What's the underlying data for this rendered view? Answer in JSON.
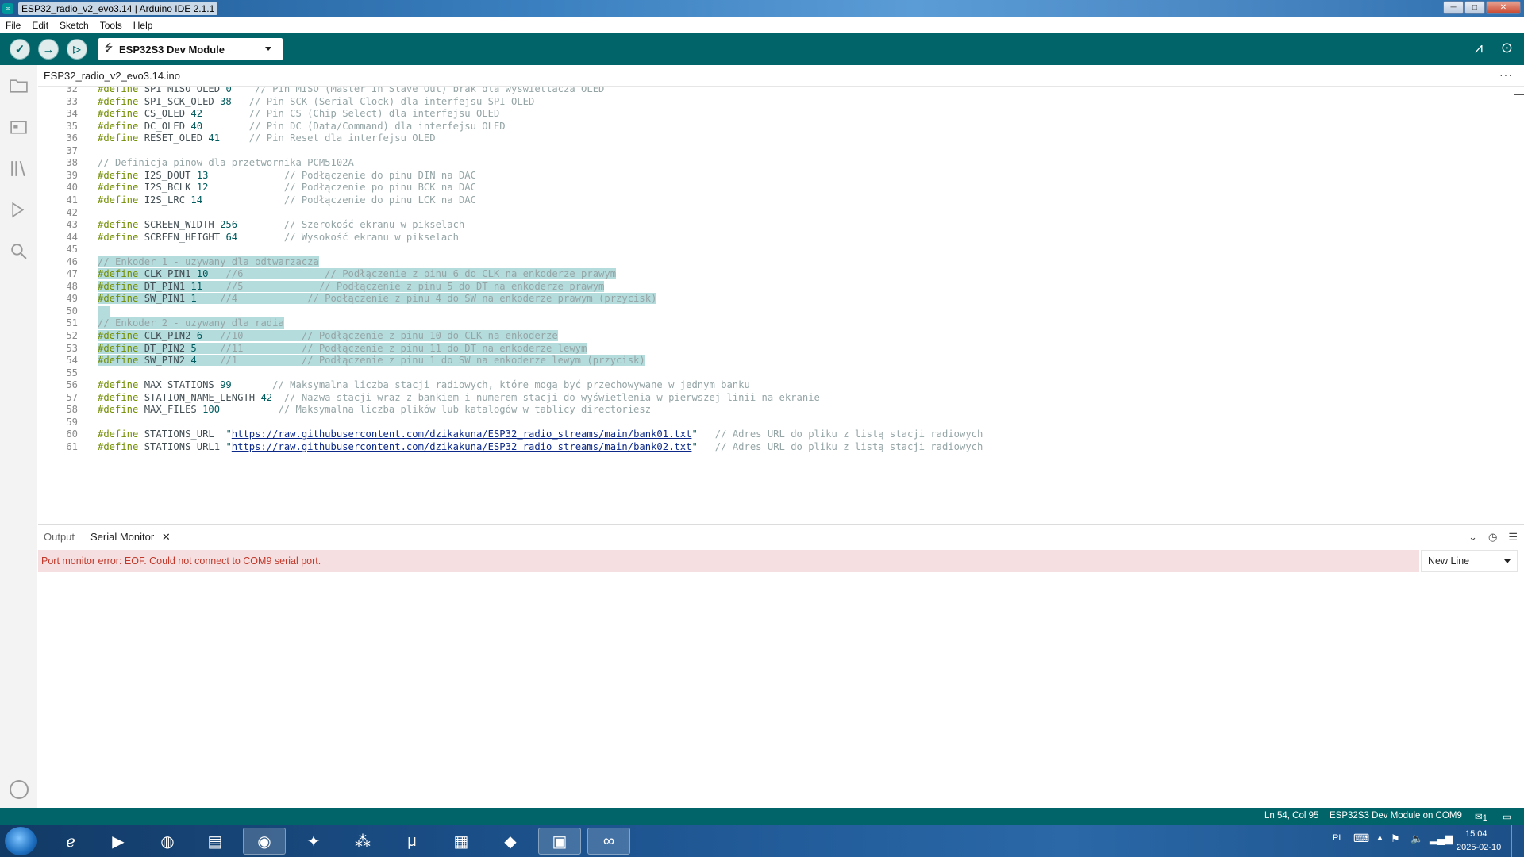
{
  "window": {
    "title": "ESP32_radio_v2_evo3.14 | Arduino IDE 2.1.1",
    "controls": [
      "minimize",
      "maximize",
      "close"
    ]
  },
  "menu": [
    "File",
    "Edit",
    "Sketch",
    "Tools",
    "Help"
  ],
  "toolbar": {
    "board": "ESP32S3 Dev Module",
    "buttons": [
      "verify",
      "upload",
      "debug"
    ]
  },
  "editor": {
    "file_tab": "ESP32_radio_v2_evo3.14.ino",
    "lines": [
      {
        "n": "32",
        "segs": [
          [
            "kw",
            "#define "
          ],
          [
            "",
            "SPI_MISO_OLED "
          ],
          [
            "num",
            "0"
          ],
          [
            "cm",
            "    // Pin MISO (Master In Slave Out) brak dla wyświetlacza OLED"
          ]
        ]
      },
      {
        "n": "33",
        "segs": [
          [
            "kw",
            "#define "
          ],
          [
            "",
            "SPI_SCK_OLED "
          ],
          [
            "num",
            "38"
          ],
          [
            "cm",
            "   // Pin SCK (Serial Clock) dla interfejsu SPI OLED"
          ]
        ]
      },
      {
        "n": "34",
        "segs": [
          [
            "kw",
            "#define "
          ],
          [
            "",
            "CS_OLED "
          ],
          [
            "num",
            "42"
          ],
          [
            "cm",
            "        // Pin CS (Chip Select) dla interfejsu OLED"
          ]
        ]
      },
      {
        "n": "35",
        "segs": [
          [
            "kw",
            "#define "
          ],
          [
            "",
            "DC_OLED "
          ],
          [
            "num",
            "40"
          ],
          [
            "cm",
            "        // Pin DC (Data/Command) dla interfejsu OLED"
          ]
        ]
      },
      {
        "n": "36",
        "segs": [
          [
            "kw",
            "#define "
          ],
          [
            "",
            "RESET_OLED "
          ],
          [
            "num",
            "41"
          ],
          [
            "cm",
            "     // Pin Reset dla interfejsu OLED"
          ]
        ]
      },
      {
        "n": "37",
        "segs": []
      },
      {
        "n": "38",
        "segs": [
          [
            "cm",
            "// Definicja pinow dla przetwornika PCM5102A"
          ]
        ]
      },
      {
        "n": "39",
        "segs": [
          [
            "kw",
            "#define "
          ],
          [
            "",
            "I2S_DOUT "
          ],
          [
            "num",
            "13"
          ],
          [
            "cm",
            "             // Podłączenie do pinu DIN na DAC"
          ]
        ]
      },
      {
        "n": "40",
        "segs": [
          [
            "kw",
            "#define "
          ],
          [
            "",
            "I2S_BCLK "
          ],
          [
            "num",
            "12"
          ],
          [
            "cm",
            "             // Podłączenie po pinu BCK na DAC"
          ]
        ]
      },
      {
        "n": "41",
        "segs": [
          [
            "kw",
            "#define "
          ],
          [
            "",
            "I2S_LRC "
          ],
          [
            "num",
            "14"
          ],
          [
            "cm",
            "              // Podłączenie do pinu LCK na DAC"
          ]
        ]
      },
      {
        "n": "42",
        "segs": []
      },
      {
        "n": "43",
        "segs": [
          [
            "kw",
            "#define "
          ],
          [
            "",
            "SCREEN_WIDTH "
          ],
          [
            "num",
            "256"
          ],
          [
            "cm",
            "        // Szerokość ekranu w pikselach"
          ]
        ]
      },
      {
        "n": "44",
        "segs": [
          [
            "kw",
            "#define "
          ],
          [
            "",
            "SCREEN_HEIGHT "
          ],
          [
            "num",
            "64"
          ],
          [
            "cm",
            "        // Wysokość ekranu w pikselach"
          ]
        ]
      },
      {
        "n": "45",
        "segs": []
      },
      {
        "n": "46",
        "sel": true,
        "segs": [
          [
            "cm",
            "// Enkoder 1 - uzywany dla odtwarzacza"
          ]
        ]
      },
      {
        "n": "47",
        "sel": true,
        "segs": [
          [
            "kw",
            "#define "
          ],
          [
            "",
            "CLK_PIN1 "
          ],
          [
            "num",
            "10"
          ],
          [
            "cm",
            "   //6              // Podłączenie z pinu 6 do CLK na enkoderze prawym"
          ]
        ]
      },
      {
        "n": "48",
        "sel": true,
        "segs": [
          [
            "kw",
            "#define "
          ],
          [
            "",
            "DT_PIN1 "
          ],
          [
            "num",
            "11"
          ],
          [
            "cm",
            "    //5             // Podłączenie z pinu 5 do DT na enkoderze prawym"
          ]
        ]
      },
      {
        "n": "49",
        "sel": true,
        "segs": [
          [
            "kw",
            "#define "
          ],
          [
            "",
            "SW_PIN1 "
          ],
          [
            "num",
            "1"
          ],
          [
            "cm",
            "    //4            // Podłączenie z pinu 4 do SW na enkoderze prawym (przycisk)"
          ]
        ]
      },
      {
        "n": "50",
        "sel": true,
        "segs": [
          [
            "",
            "  "
          ]
        ]
      },
      {
        "n": "51",
        "sel": true,
        "segs": [
          [
            "cm",
            "// Enkoder 2 - uzywany dla radia"
          ]
        ]
      },
      {
        "n": "52",
        "sel": true,
        "segs": [
          [
            "kw",
            "#define "
          ],
          [
            "",
            "CLK_PIN2 "
          ],
          [
            "num",
            "6"
          ],
          [
            "cm",
            "   //10          // Podłączenie z pinu 10 do CLK na enkoderze"
          ]
        ]
      },
      {
        "n": "53",
        "sel": true,
        "segs": [
          [
            "kw",
            "#define "
          ],
          [
            "",
            "DT_PIN2 "
          ],
          [
            "num",
            "5"
          ],
          [
            "cm",
            "    //11          // Podłączenie z pinu 11 do DT na enkoderze lewym"
          ]
        ]
      },
      {
        "n": "54",
        "sel": true,
        "segs": [
          [
            "kw",
            "#define "
          ],
          [
            "",
            "SW_PIN2 "
          ],
          [
            "num",
            "4"
          ],
          [
            "cm",
            "    //1           // Podłączenie z pinu 1 do SW na enkoderze lewym (przycisk)"
          ]
        ]
      },
      {
        "n": "55",
        "segs": []
      },
      {
        "n": "56",
        "segs": [
          [
            "kw",
            "#define "
          ],
          [
            "",
            "MAX_STATIONS "
          ],
          [
            "num",
            "99"
          ],
          [
            "cm",
            "       // Maksymalna liczba stacji radiowych, które mogą być przechowywane w jednym banku"
          ]
        ]
      },
      {
        "n": "57",
        "segs": [
          [
            "kw",
            "#define "
          ],
          [
            "",
            "STATION_NAME_LENGTH "
          ],
          [
            "num",
            "42"
          ],
          [
            "cm",
            "  // Nazwa stacji wraz z bankiem i numerem stacji do wyświetlenia w pierwszej linii na ekranie"
          ]
        ]
      },
      {
        "n": "58",
        "segs": [
          [
            "kw",
            "#define "
          ],
          [
            "",
            "MAX_FILES "
          ],
          [
            "num",
            "100"
          ],
          [
            "cm",
            "          // Maksymalna liczba plików lub katalogów w tablicy directoriesz"
          ]
        ]
      },
      {
        "n": "59",
        "segs": []
      },
      {
        "n": "60",
        "segs": [
          [
            "kw",
            "#define "
          ],
          [
            "",
            "STATIONS_URL  "
          ],
          [
            "str",
            "\""
          ],
          [
            "url",
            "https://raw.githubusercontent.com/dzikakuna/ESP32_radio_streams/main/bank01.txt"
          ],
          [
            "str",
            "\""
          ],
          [
            "cm",
            "   // Adres URL do pliku z listą stacji radiowych"
          ]
        ]
      },
      {
        "n": "61",
        "segs": [
          [
            "kw",
            "#define "
          ],
          [
            "",
            "STATIONS_URL1 "
          ],
          [
            "str",
            "\""
          ],
          [
            "url",
            "https://raw.githubusercontent.com/dzikakuna/ESP32_radio_streams/main/bank02.txt"
          ],
          [
            "str",
            "\""
          ],
          [
            "cm",
            "   // Adres URL do pliku z listą stacji radiowych"
          ]
        ]
      }
    ]
  },
  "panel": {
    "tabs": [
      "Output",
      "Serial Monitor"
    ],
    "active_tab": "Serial Monitor",
    "error": "Port monitor error: EOF. Could not connect to COM9 serial port.",
    "line_ending": "New Line"
  },
  "status": {
    "position": "Ln 54, Col 95",
    "board_port": "ESP32S3 Dev Module on COM9",
    "notifications": "1"
  },
  "taskbar": {
    "apps": [
      "internet-explorer",
      "media-player",
      "browser",
      "file-explorer",
      "chrome",
      "puzzle-app",
      "dots-app",
      "mu-editor",
      "clapperboard-321",
      "inkscape",
      "window-app",
      "arduino-ide"
    ],
    "lang": "PL",
    "time": "15:04",
    "date": "2025-02-10"
  },
  "colors": {
    "teal": "#006468",
    "selection": "#b5dcdd",
    "keyword": "#728e00",
    "comment": "#95a5a6",
    "error_bg": "#f5dfe0",
    "error_text": "#c0392b"
  }
}
